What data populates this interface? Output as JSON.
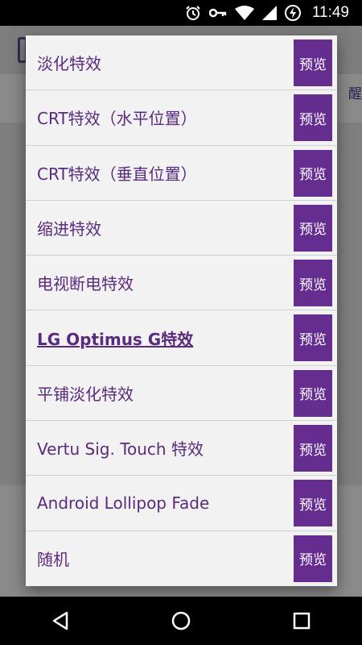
{
  "status_bar": {
    "time": "11:49",
    "icons": [
      "alarm-icon",
      "key-icon",
      "wifi-icon",
      "signal-icon",
      "battery-charging-icon"
    ]
  },
  "background": {
    "snippet": "醒"
  },
  "dialog": {
    "items": [
      {
        "label": "淡化特效",
        "preview": "预览",
        "selected": false
      },
      {
        "label": "CRT特效（水平位置）",
        "preview": "预览",
        "selected": false
      },
      {
        "label": "CRT特效（垂直位置）",
        "preview": "预览",
        "selected": false
      },
      {
        "label": "缩进特效",
        "preview": "预览",
        "selected": false
      },
      {
        "label": "电视断电特效",
        "preview": "预览",
        "selected": false
      },
      {
        "label": "LG Optimus G特效",
        "preview": "预览",
        "selected": true
      },
      {
        "label": "平铺淡化特效",
        "preview": "预览",
        "selected": false
      },
      {
        "label": "Vertu Sig. Touch 特效",
        "preview": "预览",
        "selected": false
      },
      {
        "label": "Android Lollipop Fade",
        "preview": "预览",
        "selected": false
      },
      {
        "label": "随机",
        "preview": "预览",
        "selected": false
      }
    ]
  },
  "colors": {
    "accent": "#652d90",
    "label_text": "#5a2a7e",
    "dialog_bg": "#f2f2f2"
  },
  "nav_bar": {
    "icons": [
      "back-icon",
      "home-icon",
      "recents-icon"
    ]
  }
}
